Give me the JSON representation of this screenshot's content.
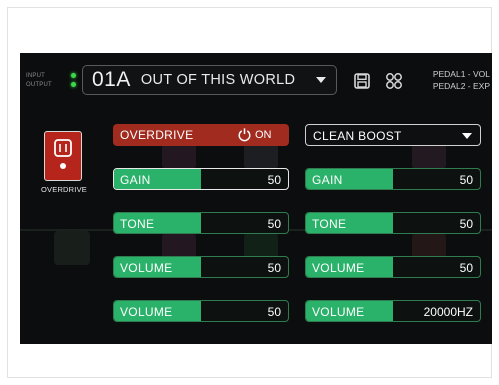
{
  "header": {
    "input_label": "INPUT",
    "output_label": "OUTPUT",
    "preset_number": "01A",
    "preset_name": "OUT OF THIS WORLD",
    "pedal1": "PEDAL1 - VOL",
    "pedal2": "PEDAL2 - EXP"
  },
  "icons": {
    "save": "save-icon",
    "grid": "grid-icon",
    "dropdown": "chevron-down-icon",
    "power": "power-icon",
    "effect": "overdrive-pedal-icon"
  },
  "effect_tile": {
    "label": "OVERDRIVE",
    "color": "#b5251b"
  },
  "left_module": {
    "name": "OVERDRIVE",
    "state": "ON",
    "color": "#a12b1f",
    "params": [
      {
        "label": "GAIN",
        "value": "50",
        "level": 0.5,
        "selected": true
      },
      {
        "label": "TONE",
        "value": "50",
        "level": 0.5,
        "selected": false
      },
      {
        "label": "VOLUME",
        "value": "50",
        "level": 0.5,
        "selected": false
      },
      {
        "label": "VOLUME",
        "value": "50",
        "level": 0.5,
        "selected": false
      }
    ]
  },
  "right_module": {
    "name": "CLEAN BOOST",
    "params": [
      {
        "label": "GAIN",
        "value": "50",
        "level": 0.5
      },
      {
        "label": "TONE",
        "value": "50",
        "level": 0.5
      },
      {
        "label": "VOLUME",
        "value": "50",
        "level": 0.5
      },
      {
        "label": "VOLUME",
        "value": "20000HZ",
        "level": 0.5
      }
    ]
  },
  "colors": {
    "accent_green": "#2bb26a",
    "led_green": "#3bd94a",
    "param_border": "#2f7d4f",
    "background": "#0b0d0e"
  }
}
